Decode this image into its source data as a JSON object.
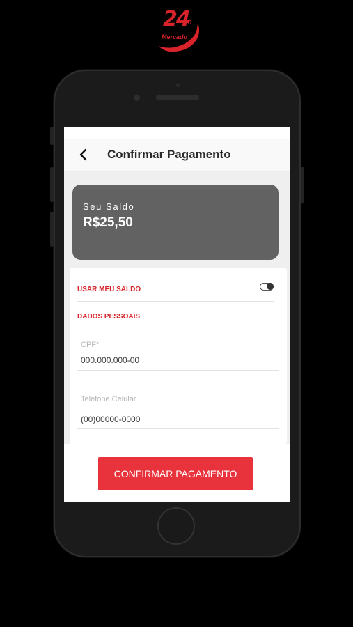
{
  "logo": {
    "number": "24",
    "suffix": "h",
    "word": "Mercado"
  },
  "header": {
    "title": "Confirmar Pagamento"
  },
  "balance": {
    "label": "Seu Saldo",
    "value": "R$25,50"
  },
  "use_balance": {
    "label": "USAR MEU SALDO",
    "enabled": false
  },
  "personal": {
    "section_label": "DADOS PESSOAIS",
    "cpf": {
      "label": "CPF*",
      "value": "000.000.000-00"
    },
    "phone": {
      "label": "Telefone Celular",
      "value": "(00)00000-0000"
    }
  },
  "actions": {
    "confirm_label": "CONFIRMAR PAGAMENTO"
  },
  "colors": {
    "accent": "#e8323c",
    "label_red": "#d8232a",
    "card": "#626262"
  }
}
